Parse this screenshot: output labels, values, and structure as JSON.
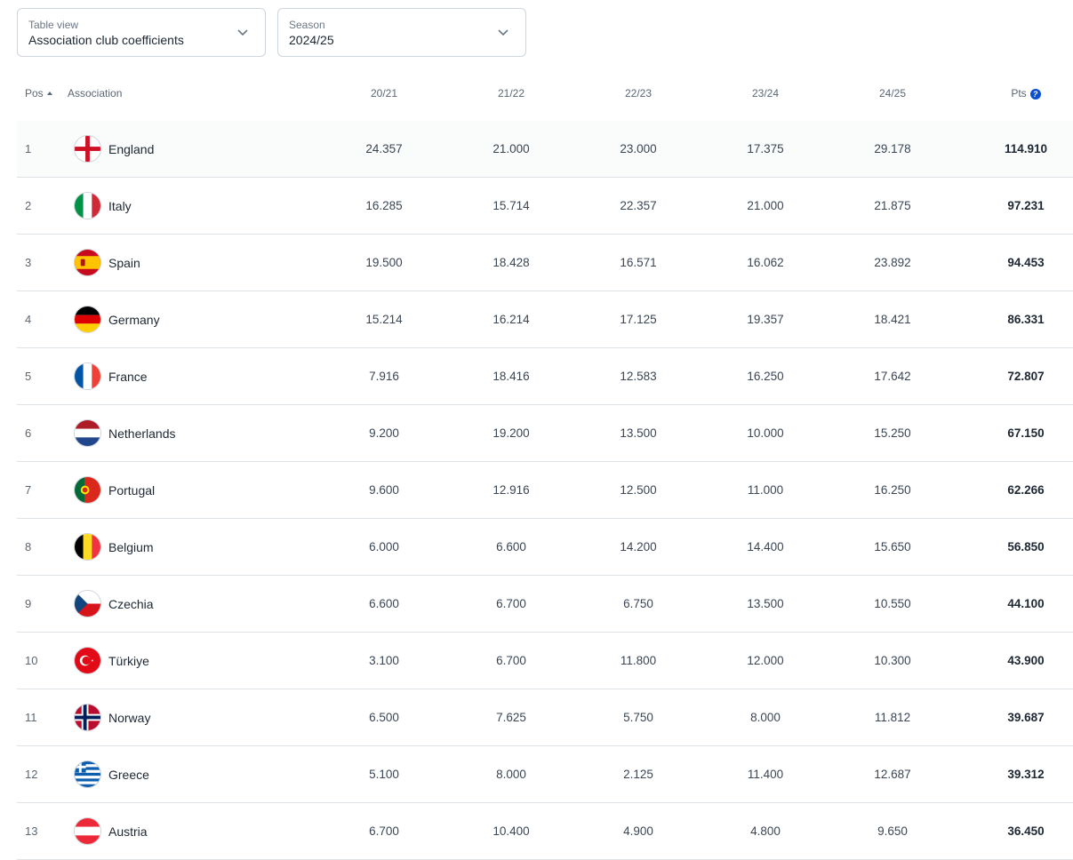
{
  "filters": {
    "view": {
      "label": "Table view",
      "value": "Association club coefficients"
    },
    "season": {
      "label": "Season",
      "value": "2024/25"
    }
  },
  "columns": {
    "pos": "Pos",
    "association": "Association",
    "s1": "20/21",
    "s2": "21/22",
    "s3": "22/23",
    "s4": "23/24",
    "s5": "24/25",
    "pts": "Pts"
  },
  "rows": [
    {
      "pos": "1",
      "name": "England",
      "flag": "england-flag-icon",
      "v": [
        "24.357",
        "21.000",
        "23.000",
        "17.375",
        "29.178"
      ],
      "pts": "114.910"
    },
    {
      "pos": "2",
      "name": "Italy",
      "flag": "italy-flag-icon",
      "v": [
        "16.285",
        "15.714",
        "22.357",
        "21.000",
        "21.875"
      ],
      "pts": "97.231"
    },
    {
      "pos": "3",
      "name": "Spain",
      "flag": "spain-flag-icon",
      "v": [
        "19.500",
        "18.428",
        "16.571",
        "16.062",
        "23.892"
      ],
      "pts": "94.453"
    },
    {
      "pos": "4",
      "name": "Germany",
      "flag": "germany-flag-icon",
      "v": [
        "15.214",
        "16.214",
        "17.125",
        "19.357",
        "18.421"
      ],
      "pts": "86.331"
    },
    {
      "pos": "5",
      "name": "France",
      "flag": "france-flag-icon",
      "v": [
        "7.916",
        "18.416",
        "12.583",
        "16.250",
        "17.642"
      ],
      "pts": "72.807"
    },
    {
      "pos": "6",
      "name": "Netherlands",
      "flag": "netherlands-flag-icon",
      "v": [
        "9.200",
        "19.200",
        "13.500",
        "10.000",
        "15.250"
      ],
      "pts": "67.150"
    },
    {
      "pos": "7",
      "name": "Portugal",
      "flag": "portugal-flag-icon",
      "v": [
        "9.600",
        "12.916",
        "12.500",
        "11.000",
        "16.250"
      ],
      "pts": "62.266"
    },
    {
      "pos": "8",
      "name": "Belgium",
      "flag": "belgium-flag-icon",
      "v": [
        "6.000",
        "6.600",
        "14.200",
        "14.400",
        "15.650"
      ],
      "pts": "56.850"
    },
    {
      "pos": "9",
      "name": "Czechia",
      "flag": "czechia-flag-icon",
      "v": [
        "6.600",
        "6.700",
        "6.750",
        "13.500",
        "10.550"
      ],
      "pts": "44.100"
    },
    {
      "pos": "10",
      "name": "Türkiye",
      "flag": "turkiye-flag-icon",
      "v": [
        "3.100",
        "6.700",
        "11.800",
        "12.000",
        "10.300"
      ],
      "pts": "43.900"
    },
    {
      "pos": "11",
      "name": "Norway",
      "flag": "norway-flag-icon",
      "v": [
        "6.500",
        "7.625",
        "5.750",
        "8.000",
        "11.812"
      ],
      "pts": "39.687"
    },
    {
      "pos": "12",
      "name": "Greece",
      "flag": "greece-flag-icon",
      "v": [
        "5.100",
        "8.000",
        "2.125",
        "11.400",
        "12.687"
      ],
      "pts": "39.312"
    },
    {
      "pos": "13",
      "name": "Austria",
      "flag": "austria-flag-icon",
      "v": [
        "6.700",
        "10.400",
        "4.900",
        "4.800",
        "9.650"
      ],
      "pts": "36.450"
    }
  ]
}
